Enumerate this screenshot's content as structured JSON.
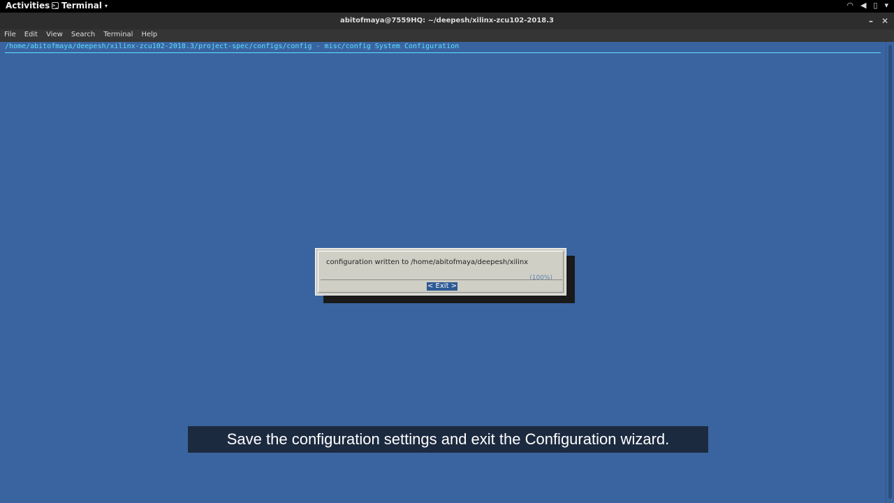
{
  "topbar": {
    "activities": "Activities",
    "app_name": "Terminal",
    "tray_icons": [
      "wifi-icon",
      "volume-icon",
      "battery-icon",
      "power-menu-icon"
    ]
  },
  "window": {
    "title": "abitofmaya@7559HQ: ~/deepesh/xilinx-zcu102-2018.3",
    "minimize": "–",
    "close": "✕"
  },
  "menubar": {
    "items": [
      "File",
      "Edit",
      "View",
      "Search",
      "Terminal",
      "Help"
    ]
  },
  "terminal": {
    "path_line": "/home/abitofmaya/deepesh/xilinx-zcu102-2018.3/project-spec/configs/config - misc/config System Configuration"
  },
  "dialog": {
    "message": "configuration written to /home/abitofmaya/deepesh/xilinx",
    "percent": "(100%)",
    "exit_button": "< Exit >"
  },
  "caption": "Save the configuration settings and exit the Configuration wizard.",
  "colors": {
    "terminal_bg": "#3a64a0",
    "path_text": "#5fe0ff",
    "dialog_bg": "#cfcfc6",
    "button_bg": "#2d5a94"
  }
}
